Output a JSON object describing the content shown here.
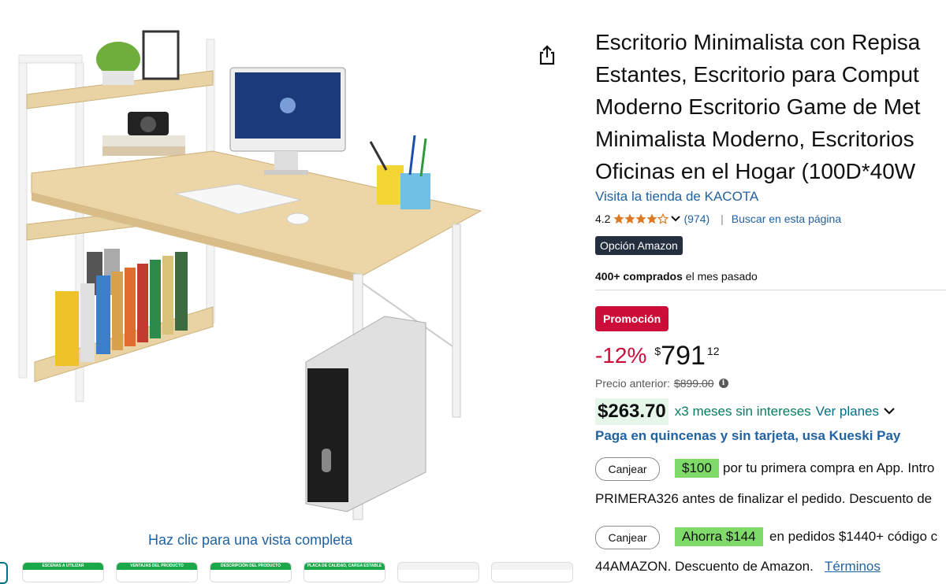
{
  "product": {
    "image_alt": "desk-product-photo",
    "view_full_link": "Haz clic para una vista completa",
    "title_lines": [
      "Escritorio Minimalista con Repisa",
      "Estantes, Escritorio para Comput",
      "Moderno Escritorio Game de Met",
      "Minimalista Moderno, Escritorios",
      "Oficinas en el Hogar (100D*40W"
    ],
    "store_link": "Visita la tienda de KACOTA",
    "thumbnails": [
      "ESCENAS A UTILIZAR",
      "VENTAJAS DEL PRODUCTO",
      "DESCRIPCIÓN DEL PRODUCTO",
      "PLACA DE CALIDAD, CARGA ESTABLE",
      "",
      ""
    ]
  },
  "rating": {
    "value": "4.2",
    "stars": 4.2,
    "count": "(974)",
    "separator": "|",
    "search_page": "Buscar en esta página"
  },
  "badges": {
    "amazon_choice": "Opción Amazon",
    "promo": "Promoción"
  },
  "bought": {
    "count": "400+ comprados",
    "period": " el mes pasado"
  },
  "price": {
    "discount": "-12%",
    "currency": "$",
    "whole": "791",
    "fraction": "12",
    "previous_label": "Precio anterior:",
    "previous_value": "$899.00"
  },
  "installments": {
    "amount": "$263.70",
    "text": "x3 meses sin intereses",
    "plans_link": "Ver planes",
    "kueski": "Paga en quincenas y sin tarjeta, usa Kueski Pay"
  },
  "offers": [
    {
      "button": "Canjear",
      "tag": "$100",
      "text": "por tu primera compra en App. Intro",
      "line2": "PRIMERA326 antes de finalizar el pedido. Descuento de"
    },
    {
      "button": "Canjear",
      "tag": "Ahorra $144",
      "text": "en pedidos $1440+ código c",
      "line2": "44AMAZON. Descuento de Amazon.",
      "terms": "Términos"
    }
  ],
  "colors": {
    "link": "#2162a1",
    "promo_red": "#cc0c39",
    "amazon_choice_bg": "#232f3e",
    "installment_green": "#067d62",
    "tag_green": "#7fda69",
    "star": "#de7921"
  }
}
